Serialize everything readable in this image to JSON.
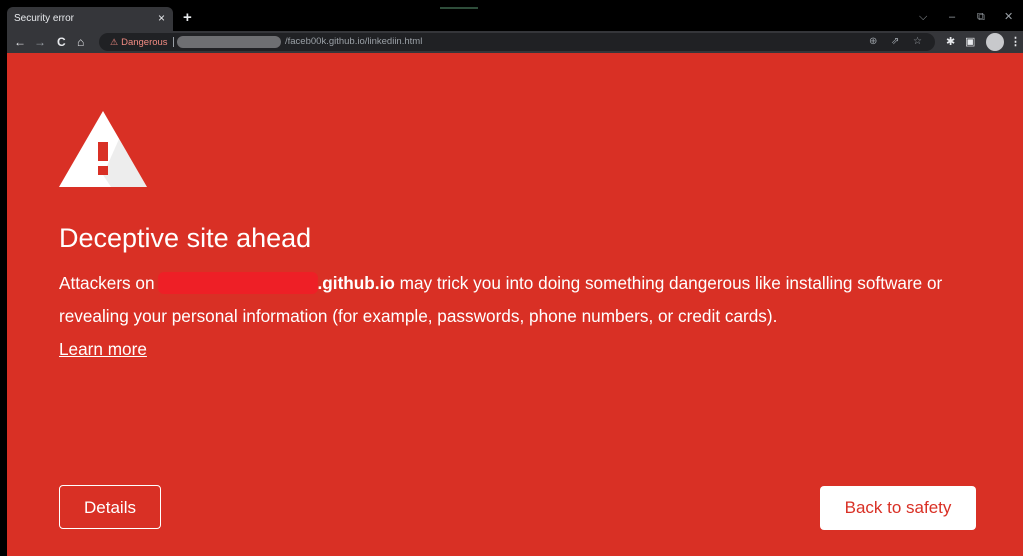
{
  "browser": {
    "tab": {
      "title": "Security error",
      "close_glyph": "×",
      "new_tab_glyph": "+"
    },
    "window_controls": {
      "tab_search": "⌵",
      "minimize": "–",
      "restore": "⧉",
      "close": "✕"
    },
    "nav": {
      "back": "←",
      "forward": "→",
      "reload": "C",
      "home": "⌂"
    },
    "omnibox": {
      "security_label": "Dangerous",
      "security_icon": "⚠",
      "url": "/faceb00k.github.io/linkediin.html",
      "icons": {
        "zoom": "⊕",
        "share": "⇗",
        "bookmark": "☆"
      }
    },
    "toolbar_icons": {
      "extensions": "✱",
      "side_panel": "▣",
      "menu": "⋮"
    }
  },
  "interstitial": {
    "heading": "Deceptive site ahead",
    "body_prefix": "Attackers on",
    "domain_suffix": ".github.io",
    "body_rest": "may trick you into doing something dangerous like installing software or revealing your personal information (for example, passwords, phone numbers, or credit cards).",
    "learn_more": "Learn more",
    "details_button": "Details",
    "back_button": "Back to safety"
  },
  "colors": {
    "danger_red": "#d93025",
    "redaction_red": "#ee1f26",
    "chrome_dark": "#35363a",
    "omnibox_bg": "#202124"
  }
}
